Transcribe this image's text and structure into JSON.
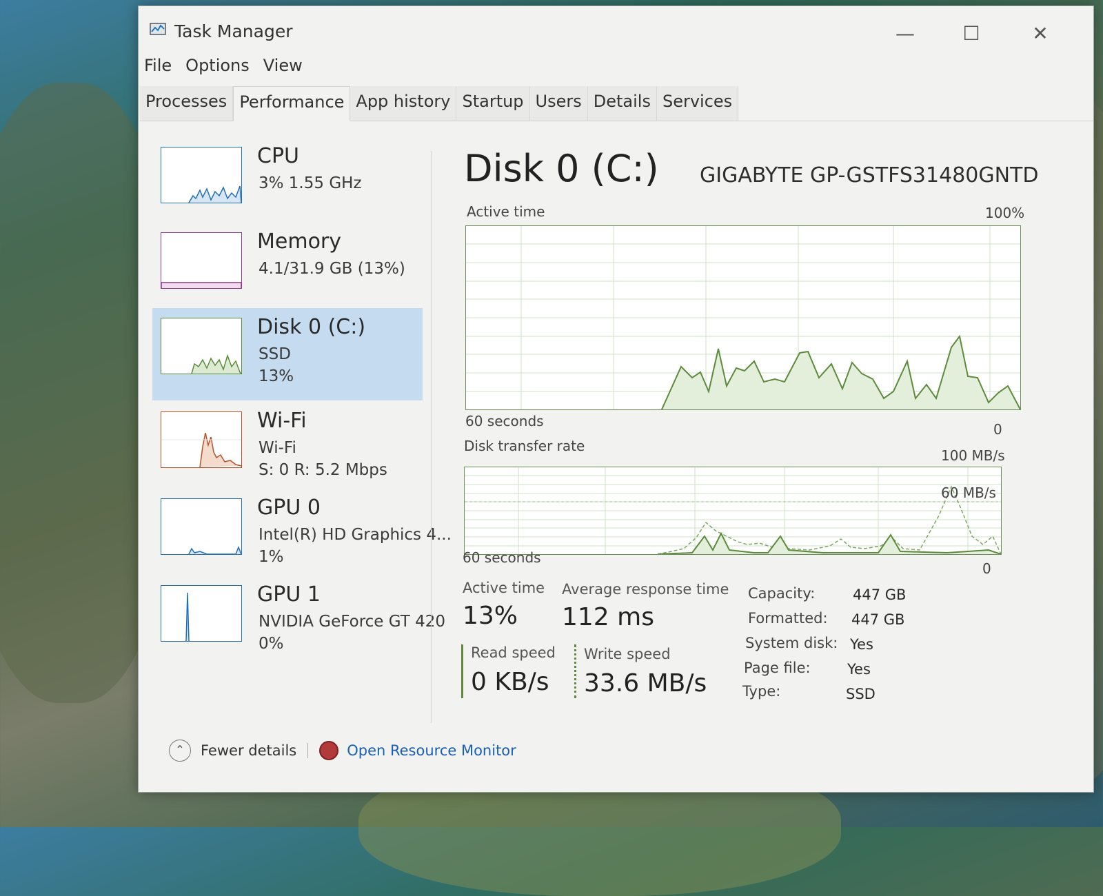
{
  "window": {
    "title": "Task Manager"
  },
  "menu": [
    "File",
    "Options",
    "View"
  ],
  "tabs": [
    {
      "label": "Processes"
    },
    {
      "label": "Performance"
    },
    {
      "label": "App history"
    },
    {
      "label": "Startup"
    },
    {
      "label": "Users"
    },
    {
      "label": "Details"
    },
    {
      "label": "Services"
    }
  ],
  "sidebar": {
    "items": [
      {
        "name": "CPU",
        "line1": "3% 1.55 GHz",
        "line2": ""
      },
      {
        "name": "Memory",
        "line1": "4.1/31.9 GB (13%)",
        "line2": ""
      },
      {
        "name": "Disk 0 (C:)",
        "line1": "SSD",
        "line2": "13%"
      },
      {
        "name": "Wi-Fi",
        "line1": "Wi-Fi",
        "line2": "S: 0 R: 5.2 Mbps"
      },
      {
        "name": "GPU 0",
        "line1": "Intel(R) HD Graphics 4...",
        "line2": "1%"
      },
      {
        "name": "GPU 1",
        "line1": "NVIDIA GeForce GT 420",
        "line2": "0%"
      }
    ]
  },
  "main": {
    "title": "Disk 0 (C:)",
    "device": "GIGABYTE GP-GSTFS31480GNTD",
    "active_time_graph": {
      "label": "Active time",
      "max": "100%",
      "time": "60 seconds",
      "min": "0"
    },
    "transfer_graph": {
      "label": "Disk transfer rate",
      "max": "100 MB/s",
      "mark": "60 MB/s",
      "time": "60 seconds",
      "min": "0"
    }
  },
  "stats": {
    "active_time": {
      "label": "Active time",
      "value": "13%"
    },
    "avg_response": {
      "label": "Average response time",
      "value": "112 ms"
    },
    "read_speed": {
      "label": "Read speed",
      "value": "0 KB/s"
    },
    "write_speed": {
      "label": "Write speed",
      "value": "33.6 MB/s"
    }
  },
  "properties": [
    {
      "key": "Capacity:",
      "value": "447 GB"
    },
    {
      "key": "Formatted:",
      "value": "447 GB"
    },
    {
      "key": "System disk:",
      "value": "Yes"
    },
    {
      "key": "Page file:",
      "value": "Yes"
    },
    {
      "key": "Type:",
      "value": "SSD"
    }
  ],
  "footer": {
    "fewer_details": "Fewer details",
    "resource_monitor": "Open Resource Monitor"
  },
  "colors": {
    "accent_selected": "#c4dbf0",
    "disk_line": "#5d8a3c",
    "cpu_line": "#1f6fb8",
    "wifi_line": "#b5522b",
    "link": "#1a5fb4"
  }
}
